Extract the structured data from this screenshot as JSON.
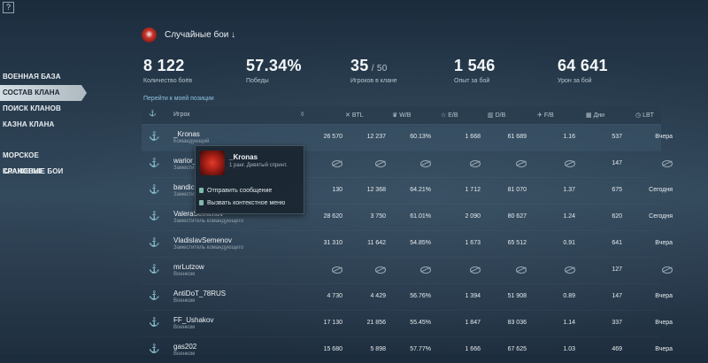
{
  "help_button": "?",
  "nav": {
    "items": [
      {
        "label": "ВОЕННАЯ БАЗА",
        "active": false
      },
      {
        "label": "СОСТАВ КЛАНА",
        "active": true
      },
      {
        "label": "ПОИСК КЛАНОВ",
        "active": false
      },
      {
        "label": "КАЗНА КЛАНА",
        "active": false
      }
    ],
    "items2": [
      {
        "label": "МОРСКОЕ СРАЖЕНИЕ"
      },
      {
        "label": "КЛАНОВЫЕ БОИ"
      }
    ]
  },
  "header": {
    "mode": "Случайные бои ↓"
  },
  "stats": [
    {
      "value": "8 122",
      "label": "Количество боёв"
    },
    {
      "value": "57.34%",
      "label": "Победы"
    },
    {
      "value": "35",
      "suffix": " / 50",
      "label": "Игроков в клане"
    },
    {
      "value": "1 546",
      "label": "Опыт за бой"
    },
    {
      "value": "64 641",
      "label": "Урон за бой"
    }
  ],
  "goto_link": "Перейти к моей позиции",
  "columns": {
    "player": "Игрок",
    "btl": "BTL",
    "wb": "W/B",
    "eb": "E/B",
    "db": "D/B",
    "fb": "F/B",
    "days": "Дни",
    "lbt": "LBT"
  },
  "rows": [
    {
      "name": "_Kronas",
      "role": "Командующий",
      "battles": "26 570",
      "btl": "12 237",
      "wb": "60.13%",
      "eb": "1 668",
      "db": "61 689",
      "fb": "1.16",
      "days": "537",
      "lbt": "Вчера",
      "hidden": false
    },
    {
      "name": "warior_",
      "role": "Заместитель командующего",
      "battles": "",
      "btl": "",
      "wb": "",
      "eb": "",
      "db": "",
      "fb": "",
      "days": "147",
      "lbt": "",
      "hidden": true
    },
    {
      "name": "bandic",
      "role": "Заместитель командующего",
      "battles": "130",
      "btl": "12 368",
      "wb": "64.21%",
      "eb": "1 712",
      "db": "81 070",
      "fb": "1.37",
      "days": "675",
      "lbt": "Сегодня",
      "hidden": false
    },
    {
      "name": "ValeraSemenov",
      "role": "Заместитель командующего",
      "battles": "28 620",
      "btl": "3 750",
      "wb": "61.01%",
      "eb": "2 090",
      "db": "80 627",
      "fb": "1.24",
      "days": "620",
      "lbt": "Сегодня",
      "hidden": false
    },
    {
      "name": "VladislavSemenov",
      "role": "Заместитель командующего",
      "battles": "31 310",
      "btl": "11 642",
      "wb": "54.85%",
      "eb": "1 673",
      "db": "65 512",
      "fb": "0.91",
      "days": "641",
      "lbt": "Вчера",
      "hidden": false
    },
    {
      "name": "mrLutzow",
      "role": "Военком",
      "battles": "",
      "btl": "",
      "wb": "",
      "eb": "",
      "db": "",
      "fb": "",
      "days": "127",
      "lbt": "",
      "hidden": true
    },
    {
      "name": "AntiDoT_78RUS",
      "role": "Военком",
      "battles": "4 730",
      "btl": "4 429",
      "wb": "56.76%",
      "eb": "1 394",
      "db": "51 908",
      "fb": "0.89",
      "days": "147",
      "lbt": "Вчера",
      "hidden": false
    },
    {
      "name": "FF_Ushakov",
      "role": "Военком",
      "battles": "17 130",
      "btl": "21 856",
      "wb": "55.45%",
      "eb": "1 847",
      "db": "83 036",
      "fb": "1.14",
      "days": "337",
      "lbt": "Вчера",
      "hidden": false
    },
    {
      "name": "gas202",
      "role": "Военком",
      "battles": "15 680",
      "btl": "5 898",
      "wb": "57.77%",
      "eb": "1 666",
      "db": "67 625",
      "fb": "1.03",
      "days": "469",
      "lbt": "Вчера",
      "hidden": false
    }
  ],
  "popup": {
    "name": "_Kronas",
    "subtitle": "1 ранг. Девятый спринт.",
    "menu": [
      "Отправить сообщение",
      "Вызвать контекстное меню"
    ]
  }
}
